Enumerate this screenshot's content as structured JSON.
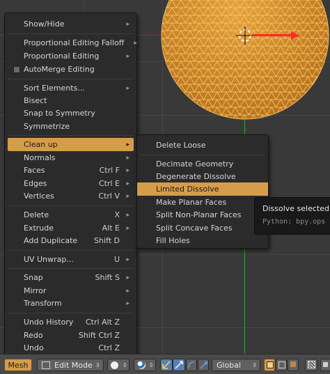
{
  "context_menu": {
    "items": [
      {
        "label": "Show/Hide",
        "shortcut": "",
        "arrow": "▸"
      },
      {
        "label": "Proportional Editing Falloff",
        "shortcut": "",
        "arrow": "▸"
      },
      {
        "label": "Proportional Editing",
        "shortcut": "",
        "arrow": "▸"
      },
      {
        "label": "AutoMerge Editing",
        "shortcut": "",
        "arrow": ""
      },
      {
        "label": "Sort Elements...",
        "shortcut": "",
        "arrow": "▸"
      },
      {
        "label": "Bisect",
        "shortcut": "",
        "arrow": ""
      },
      {
        "label": "Snap to Symmetry",
        "shortcut": "",
        "arrow": ""
      },
      {
        "label": "Symmetrize",
        "shortcut": "",
        "arrow": ""
      },
      {
        "label": "Clean up",
        "shortcut": "",
        "arrow": "▸"
      },
      {
        "label": "Normals",
        "shortcut": "",
        "arrow": "▸"
      },
      {
        "label": "Faces",
        "shortcut": "Ctrl F",
        "arrow": "▸"
      },
      {
        "label": "Edges",
        "shortcut": "Ctrl E",
        "arrow": "▸"
      },
      {
        "label": "Vertices",
        "shortcut": "Ctrl V",
        "arrow": "▸"
      },
      {
        "label": "Delete",
        "shortcut": "X",
        "arrow": "▸"
      },
      {
        "label": "Extrude",
        "shortcut": "Alt E",
        "arrow": "▸"
      },
      {
        "label": "Add Duplicate",
        "shortcut": "Shift D",
        "arrow": ""
      },
      {
        "label": "UV Unwrap...",
        "shortcut": "U",
        "arrow": "▸"
      },
      {
        "label": "Snap",
        "shortcut": "Shift S",
        "arrow": "▸"
      },
      {
        "label": "Mirror",
        "shortcut": "",
        "arrow": "▸"
      },
      {
        "label": "Transform",
        "shortcut": "",
        "arrow": "▸"
      },
      {
        "label": "Undo History",
        "shortcut": "Ctrl Alt Z",
        "arrow": ""
      },
      {
        "label": "Redo",
        "shortcut": "Shift Ctrl Z",
        "arrow": ""
      },
      {
        "label": "Undo",
        "shortcut": "Ctrl Z",
        "arrow": ""
      }
    ]
  },
  "cleanup_submenu": {
    "items": [
      {
        "label": "Delete Loose"
      },
      {
        "label": "Decimate Geometry"
      },
      {
        "label": "Degenerate Dissolve"
      },
      {
        "label": "Limited Dissolve"
      },
      {
        "label": "Make Planar Faces"
      },
      {
        "label": "Split Non-Planar Faces"
      },
      {
        "label": "Split Concave Faces"
      },
      {
        "label": "Fill Holes"
      }
    ]
  },
  "tooltip": {
    "title": "Dissolve selected",
    "python": "Python: bpy.ops"
  },
  "header_bar": {
    "mesh_menu": "Mesh",
    "mode": "Edit Mode",
    "orientation": "Global"
  },
  "colors": {
    "accent": "#d59d4a",
    "mesh_fill": "#d48a24",
    "wire": "#f6c86a",
    "axis_x": "#d42020",
    "axis_y": "#38c038",
    "manipulator": "#ff2a2a"
  },
  "icons": [
    "circle-icon",
    "viewport-shading-icon",
    "pivot-icon",
    "manipulator-icon",
    "translate-icon",
    "rotate-icon",
    "scale-icon",
    "vertex-select-icon",
    "edge-select-icon",
    "face-select-icon",
    "occlude-icon"
  ]
}
